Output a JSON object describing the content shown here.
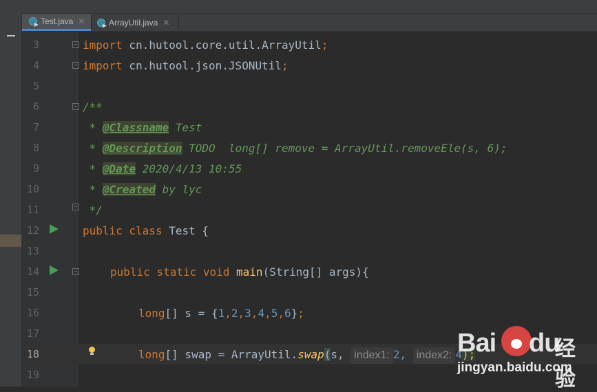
{
  "tabs": [
    {
      "label": "Test.java",
      "active": true
    },
    {
      "label": "ArrayUtil.java",
      "active": false
    }
  ],
  "lines": [
    {
      "number": "3"
    },
    {
      "number": "4"
    },
    {
      "number": "5"
    },
    {
      "number": "6"
    },
    {
      "number": "7"
    },
    {
      "number": "8"
    },
    {
      "number": "9"
    },
    {
      "number": "10"
    },
    {
      "number": "11"
    },
    {
      "number": "12"
    },
    {
      "number": "13"
    },
    {
      "number": "14"
    },
    {
      "number": "15"
    },
    {
      "number": "16"
    },
    {
      "number": "17"
    },
    {
      "number": "18"
    },
    {
      "number": "19"
    }
  ],
  "code": {
    "l3_kw": "import",
    "l3_rest": " cn.hutool.core.util.ArrayUtil",
    "l3_semi": ";",
    "l4_kw": "import",
    "l4_rest": " cn.hutool.json.JSONUtil",
    "l4_semi": ";",
    "l6": "/**",
    "l7_star": " * ",
    "l7_tag": "@Classname",
    "l7_text": " Test",
    "l8_star": " * ",
    "l8_tag": "@Description",
    "l8_text": " TODO  long[] remove = ArrayUtil.removeEle(s, 6);",
    "l9_star": " * ",
    "l9_tag": "@Date",
    "l9_text": " 2020/4/13 10:55",
    "l10_star": " * ",
    "l10_tag": "@Created",
    "l10_text": " by lyc",
    "l11": " */",
    "l12_kw": "public class",
    "l12_rest": " Test {",
    "l14_kw": "public static void",
    "l14_fn": "main",
    "l14_rest": "(String[] args){",
    "l16_kw": "long",
    "l16_a": "[] s = {",
    "l16_n1": "1",
    "l16_n2": "2",
    "l16_n3": "3",
    "l16_n4": "4",
    "l16_n5": "5",
    "l16_n6": "6",
    "comma": ",",
    "l16_end": "}",
    "l16_semi": ";",
    "l18_kw": "long",
    "l18_a": "[] swap = ArrayUtil.",
    "l18_fn": "swap",
    "l18_paren": "(",
    "l18_s": "s,",
    "l18_hint1": "index1:",
    "l18_n1": "2,",
    "l18_hint2": "index2:",
    "l18_n2": "4",
    "l18_close": ");"
  },
  "watermark": {
    "logo_text": "Bai",
    "logo_text2": "du",
    "cn_text": "经验",
    "url": "jingyan.baidu.com"
  }
}
